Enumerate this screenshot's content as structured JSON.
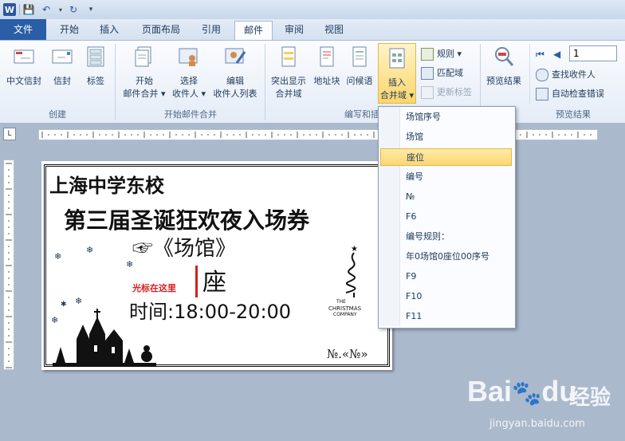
{
  "titlebar": {
    "word_icon": "W",
    "save_icon": "💾",
    "undo_icon": "↶",
    "redo_icon": "↻",
    "menu_icon": "▾"
  },
  "tabs": [
    "文件",
    "开始",
    "插入",
    "页面布局",
    "引用",
    "邮件",
    "审阅",
    "视图"
  ],
  "ribbon": {
    "create_group": {
      "label": "创建",
      "buttons": [
        "中文信封",
        "信封",
        "标签"
      ]
    },
    "merge_group": {
      "label": "开始邮件合并",
      "buttons": [
        [
          "开始",
          "邮件合并 ▾"
        ],
        [
          "选择",
          "收件人 ▾"
        ],
        [
          "编辑",
          "收件人列表"
        ]
      ]
    },
    "insert_group": {
      "label": "编写和插",
      "buttons": [
        [
          "突出显示",
          "合并域"
        ],
        [
          "地址块"
        ],
        [
          "问候语"
        ],
        [
          "插入",
          "合并域 ▾"
        ]
      ],
      "small": [
        "规则 ▾",
        "匹配域",
        "更新标签"
      ]
    },
    "preview_group": {
      "label": "预览结果",
      "preview_button": "预览结果",
      "record_value": "1",
      "small": [
        "查找收件人",
        "自动检查错误"
      ]
    }
  },
  "document": {
    "line1": "上海中学东校",
    "line2": "第三届圣诞狂欢夜入场券",
    "line3": "☞《场馆》",
    "seat": "座",
    "cursor_note": "光标在这里",
    "time": "时间:18:00-20:00",
    "number": "№.«№»",
    "xmas_text": [
      "THE",
      "CHRISTMAS",
      "COMPANY"
    ]
  },
  "dropdown": {
    "items": [
      "场馆序号",
      "场馆",
      "座位",
      "编号",
      "№",
      "F6",
      "编号规则：",
      "年0场馆0座位00序号",
      "F9",
      "F10",
      "F11"
    ],
    "selected_index": 2
  },
  "watermark": {
    "brand": "Bai",
    "brand2": "du",
    "suffix": "经验",
    "url": "jingyan.baidu.com"
  },
  "colors": {
    "accent": "#2a5ea6",
    "red_note": "#d81e1e",
    "selected": "#fbd772"
  }
}
